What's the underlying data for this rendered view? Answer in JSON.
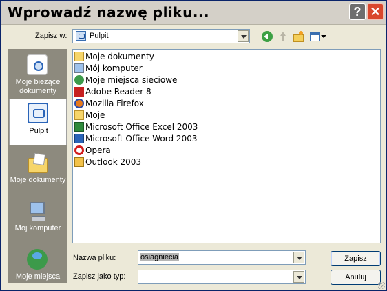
{
  "window": {
    "title": "Wprowadź nazwę pliku...",
    "help_glyph": "?",
    "close_glyph": "✕"
  },
  "toolbar": {
    "save_in_label": "Zapisz w:",
    "location_value": "Pulpit",
    "icons": [
      "back-icon",
      "up-folder-icon",
      "new-folder-icon",
      "views-menu-icon"
    ]
  },
  "places": [
    {
      "label": "Moje bieżące dokumenty",
      "icon": "recent-documents-icon"
    },
    {
      "label": "Pulpit",
      "icon": "desktop-icon",
      "selected": true
    },
    {
      "label": "Moje dokumenty",
      "icon": "my-documents-icon"
    },
    {
      "label": "Mój komputer",
      "icon": "my-computer-icon"
    },
    {
      "label": "Moje miejsca",
      "icon": "network-places-icon"
    }
  ],
  "files": [
    {
      "name": "Moje dokumenty",
      "icon": "my-documents-icon"
    },
    {
      "name": "Mój komputer",
      "icon": "my-computer-icon"
    },
    {
      "name": "Moje miejsca sieciowe",
      "icon": "network-places-icon"
    },
    {
      "name": "Adobe Reader 8",
      "icon": "adobe-reader-icon"
    },
    {
      "name": "Mozilla Firefox",
      "icon": "firefox-icon"
    },
    {
      "name": "Moje",
      "icon": "folder-icon"
    },
    {
      "name": "Microsoft Office Excel 2003",
      "icon": "excel-icon"
    },
    {
      "name": "Microsoft Office Word 2003",
      "icon": "word-icon"
    },
    {
      "name": "Opera",
      "icon": "opera-icon"
    },
    {
      "name": "Outlook 2003",
      "icon": "outlook-icon"
    }
  ],
  "form": {
    "file_name_label": "Nazwa pliku:",
    "file_name_value": "osiagniecia",
    "file_type_label": "Zapisz jako typ:",
    "file_type_value": ""
  },
  "buttons": {
    "save": "Zapisz",
    "cancel": "Anuluj"
  }
}
